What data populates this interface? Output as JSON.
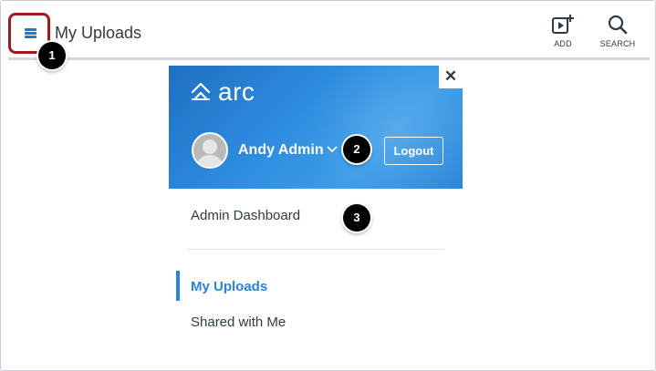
{
  "header": {
    "title": "My Uploads",
    "tools": [
      {
        "label": "ADD",
        "icon": "add-media-icon"
      },
      {
        "label": "SEARCH",
        "icon": "search-icon"
      }
    ]
  },
  "callouts": [
    "1",
    "2",
    "3"
  ],
  "panel": {
    "close_label": "✕",
    "brand": {
      "name": "arc",
      "icon": "arc-logo-icon"
    },
    "user": {
      "name": "Andy Admin",
      "icon": "chevron-down-icon"
    },
    "logout_label": "Logout",
    "admin_link": "Admin Dashboard",
    "nav": [
      {
        "label": "My Uploads",
        "active": true
      },
      {
        "label": "Shared with Me",
        "active": false
      }
    ]
  },
  "colors": {
    "accent": "#2b82d8",
    "banner": "#2f8ee0",
    "callout_border": "#9b1b1f",
    "text": "#2d3b45"
  }
}
